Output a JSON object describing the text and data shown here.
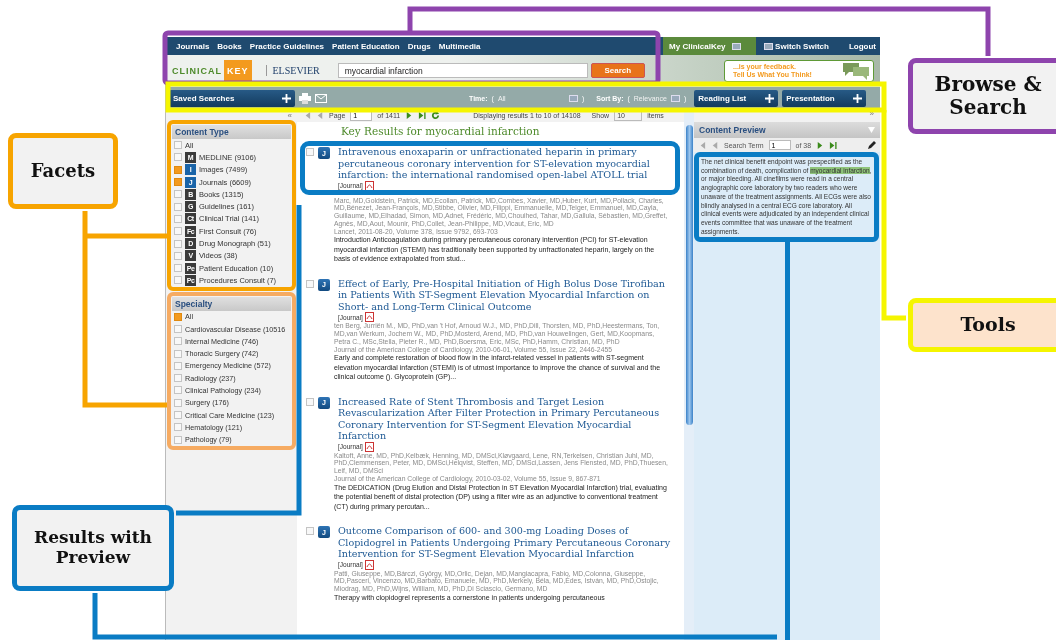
{
  "top_nav": {
    "links": [
      "Journals",
      "Books",
      "Practice Guidelines",
      "Patient Education",
      "Drugs",
      "Multimedia"
    ],
    "my_menu": "My ClinicalKey",
    "switch": "Switch Switch",
    "logout": "Logout"
  },
  "header": {
    "logo_left": "CLINICAL",
    "logo_right": "KEY",
    "publisher": "ELSEVIER",
    "search": {
      "value": "myocardial infarction",
      "button": "Search"
    },
    "feedback": [
      "...is your feedback.",
      "Tell Us What You Think!"
    ]
  },
  "toolbar": {
    "saved_searches": "Saved Searches",
    "time_label": "Time:",
    "time_open": "(",
    "time_value": "All",
    "time_close": ")",
    "sort_label": "Sort By:",
    "sort_open": "(",
    "sort_value": "Relevance",
    "sort_close": ")",
    "reading_list": "Reading List",
    "presentation": "Presentation"
  },
  "pager": {
    "collapse_left": "«",
    "page_label": "Page",
    "page": "1",
    "of": "of 1411",
    "displaying": "Displaying results 1 to 10 of 14108",
    "show": "Show",
    "count": "10",
    "items": "items",
    "collapse_right": "»"
  },
  "content_type": {
    "title": "Content Type",
    "items": [
      {
        "label": "All",
        "checked": false
      },
      {
        "badge": "M",
        "label": "MEDLINE (9106)",
        "checked": false,
        "color": "#3a3a3a"
      },
      {
        "badge": "I",
        "label": "Images (7499)",
        "checked": true,
        "color": "#1a64a8"
      },
      {
        "badge": "J",
        "label": "Journals (6609)",
        "checked": true,
        "color": "#1a64a8"
      },
      {
        "badge": "B",
        "label": "Books (1315)",
        "checked": false,
        "color": "#3a3a3a"
      },
      {
        "badge": "G",
        "label": "Guidelines (161)",
        "checked": false,
        "color": "#3a3a3a"
      },
      {
        "badge": "Ct",
        "label": "Clinical Trial (141)",
        "checked": false,
        "color": "#3a3a3a"
      },
      {
        "badge": "Fc",
        "label": "First Consult (76)",
        "checked": false,
        "color": "#3a3a3a"
      },
      {
        "badge": "D",
        "label": "Drug Monograph (51)",
        "checked": false,
        "color": "#3a3a3a"
      },
      {
        "badge": "V",
        "label": "Videos (38)",
        "checked": false,
        "color": "#3a3a3a"
      },
      {
        "badge": "Pe",
        "label": "Patient Education (10)",
        "checked": false,
        "color": "#3a3a3a"
      },
      {
        "badge": "Pc",
        "label": "Procedures Consult (7)",
        "checked": false,
        "color": "#3a3a3a"
      }
    ]
  },
  "specialty": {
    "title": "Specialty",
    "items": [
      {
        "label": "All",
        "checked": true
      },
      {
        "label": "Cardiovascular Disease (10516",
        "checked": false
      },
      {
        "label": "Internal Medicine (746)",
        "checked": false
      },
      {
        "label": "Thoracic Surgery (742)",
        "checked": false
      },
      {
        "label": "Emergency Medicine (572)",
        "checked": false
      },
      {
        "label": "Radiology (237)",
        "checked": false
      },
      {
        "label": "Clinical Pathology (234)",
        "checked": false
      },
      {
        "label": "Surgery (176)",
        "checked": false
      },
      {
        "label": "Critical Care Medicine (123)",
        "checked": false
      },
      {
        "label": "Hematology (121)",
        "checked": false
      },
      {
        "label": "Pathology (79)",
        "checked": false
      }
    ]
  },
  "results": {
    "heading": "Key Results for myocardial infarction",
    "items": [
      {
        "checked": false,
        "badge": "J",
        "title": "Intravenous enoxaparin or unfractionated heparin in primary percutaneous coronary intervention for ST-elevation myocardial infarction: the international randomised open-label ATOLL trial",
        "tag": "[Journal]",
        "authors": "Marc, MD,Goldstein, Patrick, MD,Ecollan, Patrick, MD,Combes, Xavier, MD,Huber, Kurt, MD,Pollack, Charles, MD,Bénezet, Jean-François, MD,Stibbe, Olivier, MD,Filippi, Emmanuelle, MD,Teiger, Emmanuel, MD,Cayla, Guillaume, MD,Elhadad, Simon, MD,Adnet, Frédéric, MD,Chouihed, Tahar, MD,Gallula, Sébastien, MD,Greffet, Agnès, MD,Aout, Mounir, PhD,Collet, Jean-Philippe, MD,Vicaut, Eric, MD",
        "source": "Lancet, 2011-08-20, Volume 378, Issue 9792, 693-703",
        "abstract": "Introduction Anticoagulation during primary percutaneous coronary intervention (PCI) for ST-elevation myocardial infarction (STEMI) has traditionally been supported by unfractionated heparin, largely on the basis of evidence extrapolated from stud..."
      },
      {
        "checked": false,
        "badge": "J",
        "title": "Effect of Early, Pre-Hospital Initiation of High Bolus Dose Tirofiban in Patients With ST-Segment Elevation Myocardial Infarction on Short- and Long-Term Clinical Outcome",
        "tag": "[Journal]",
        "authors": "ten Berg, Jurriën M., MD, PhD,van 't Hof, Arnoud W.J., MD, PhD,Dill, Thorsten, MD, PhD,Heestermans, Ton, MD,van Werkum, Jochem W., MD, PhD,Mosterd, Arend, MD, PhD,van Houwelingen, Gert, MD,Koopmans, Petra C., MSc,Stella, Pieter R., MD, PhD,Boersma, Eric, MSc, PhD,Hamm, Christian, MD, PhD",
        "source": "Journal of the American College of Cardiology, 2010-06-01, Volume 55, Issue 22, 2446-2455",
        "abstract": "Early and complete restoration of blood flow in the infarct-related vessel in patients with ST-segment elevation myocardial infarction (STEMI) is of utmost importance to improve the chance of survival and the clinical outcome (). Glycoprotein (GP)..."
      },
      {
        "checked": false,
        "badge": "J",
        "title": "Increased Rate of Stent Thrombosis and Target Lesion Revascularization After Filter Protection in Primary Percutaneous Coronary Intervention for ST-Segment Elevation Myocardial Infarction",
        "tag": "[Journal]",
        "authors": "Kaltoft, Anne, MD, PhD,Kelbæk, Henning, MD, DMSci,Kløvgaard, Lene, RN,Terkelsen, Christian Juhl, MD, PhD,Clemmensen, Peter, MD, DMSci,Helqvist, Steffen, MD, DMSci,Lassen, Jens Flensted, MD, PhD,Thuesen, Leif, MD, DMSci",
        "source": "Journal of the American College of Cardiology, 2010-03-02, Volume 55, Issue 9, 867-871",
        "abstract": "The DEDICATION (Drug Elution and Distal Protection in ST Elevation Myocardial Infarction) trial, evaluating the potential benefit of distal protection (DP) using a filter wire as an adjunctive to conventional treatment (CT) during primary percutan..."
      },
      {
        "checked": false,
        "badge": "J",
        "title": "Outcome Comparison of 600- and 300-mg Loading Doses of Clopidogrel in Patients Undergoing Primary Percutaneous Coronary Intervention for ST-Segment Elevation Myocardial Infarction",
        "tag": "[Journal]",
        "authors": "Patti, Giuseppe, MD,Bárczi, György, MD,Orlic, Dejan, MD,Mangiacapra, Fabio, MD,Colonna, Giuseppe, MD,Pasceri, Vincenzo, MD,Barbato, Emanuele, MD, PhD,Merkely, Béla, MD,Édes, István, MD, PhD,Ostojic, Miodrag, MD, PhD,Wijns, William, MD, PhD,Di Sciascio, Germano, MD",
        "abstract": "Therapy with clopidogrel represents a cornerstone in patients undergoing percutaneous"
      }
    ]
  },
  "preview": {
    "title": "Content Preview",
    "term_label": "Search Term",
    "term": "1",
    "of": "of 38",
    "text_before": "The net clinical benefit endpoint was prespecified as the combination of death, complication of ",
    "highlight": "myocardial infarction",
    "text_after": ", or major bleeding. All cinefilms were read in a central angiographic core laboratory by two readers who were unaware of the treatment assignments. All ECGs were also blindly analysed in a central ECG core laboratory. All clinical events were adjudicated by an independent clinical events committee that was unaware of the treatment assignments."
  },
  "callouts": [
    {
      "kind": "browse",
      "label": "Browse & Search",
      "color": "#8e44ad"
    },
    {
      "kind": "facets",
      "label": "Facets",
      "color": "#f7a400"
    },
    {
      "kind": "tools",
      "label": "Tools",
      "color": "#f5f500"
    },
    {
      "kind": "results",
      "label": "Results with Preview",
      "color": "#0a7cc4"
    }
  ]
}
